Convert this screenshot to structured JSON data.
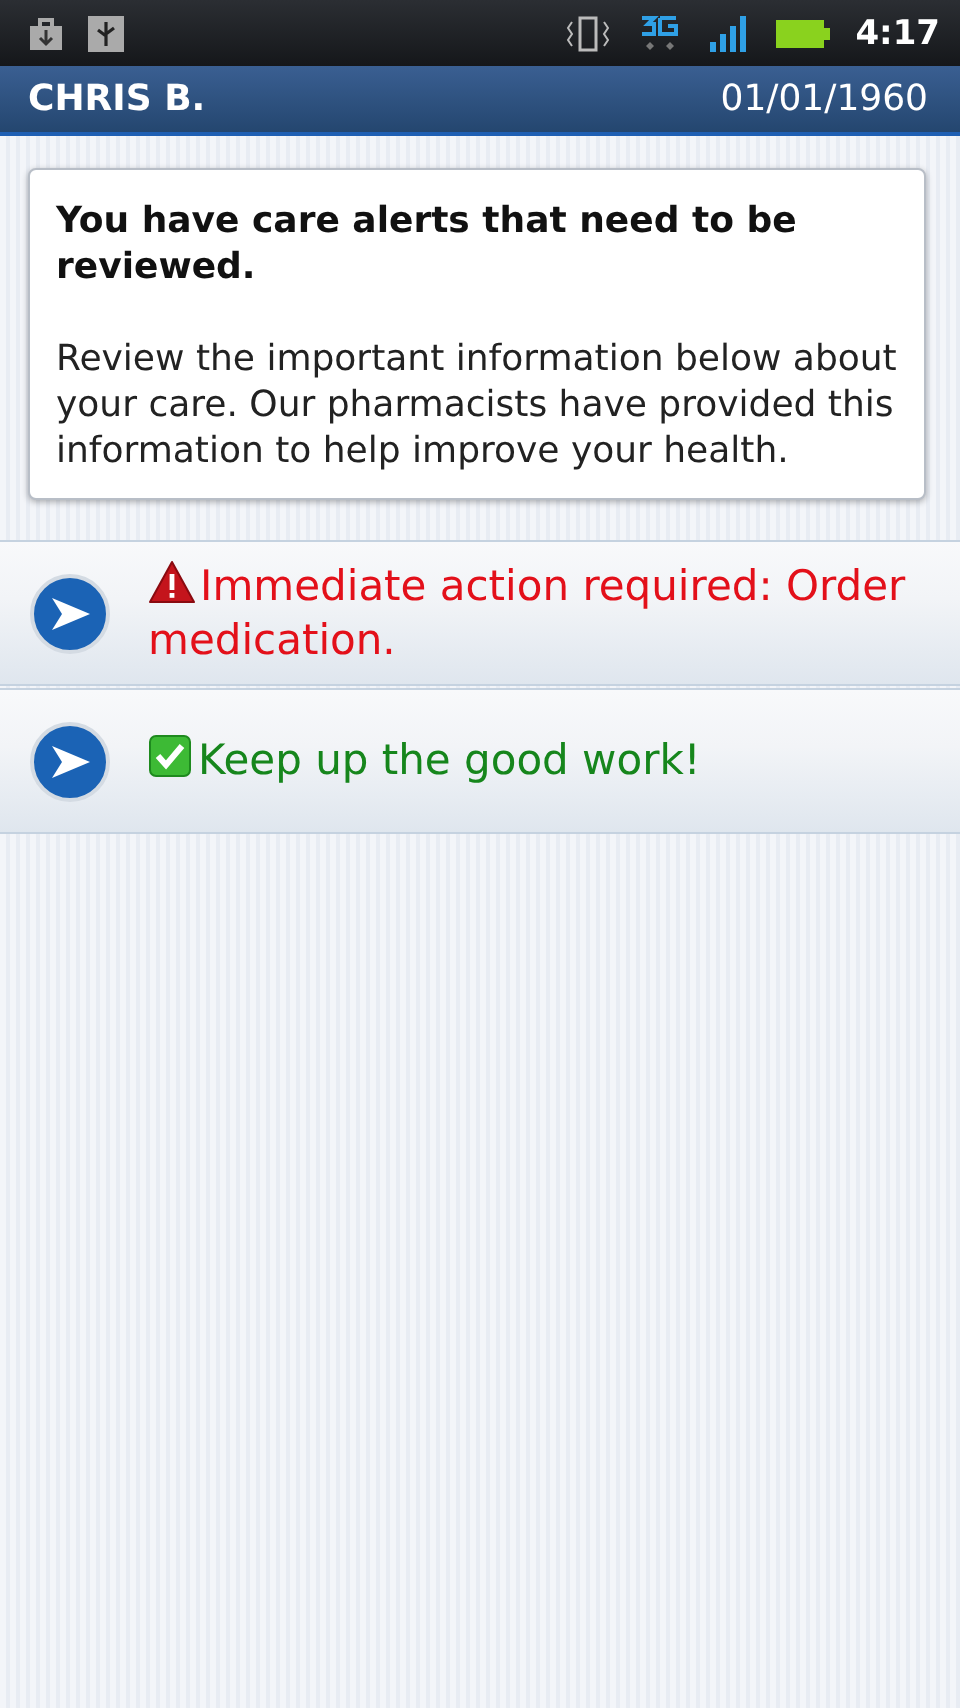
{
  "status_bar": {
    "time": "4:17"
  },
  "header": {
    "name": "CHRIS B.",
    "date": "01/01/1960"
  },
  "notice": {
    "title": "You have care alerts that need to be reviewed.",
    "body": "Review the important information below about your care. Our pharmacists have provided this information to help improve your health."
  },
  "alerts": [
    {
      "kind": "warning",
      "text": "Immediate action required: Order medication."
    },
    {
      "kind": "ok",
      "text": "Keep up the good work!"
    }
  ]
}
